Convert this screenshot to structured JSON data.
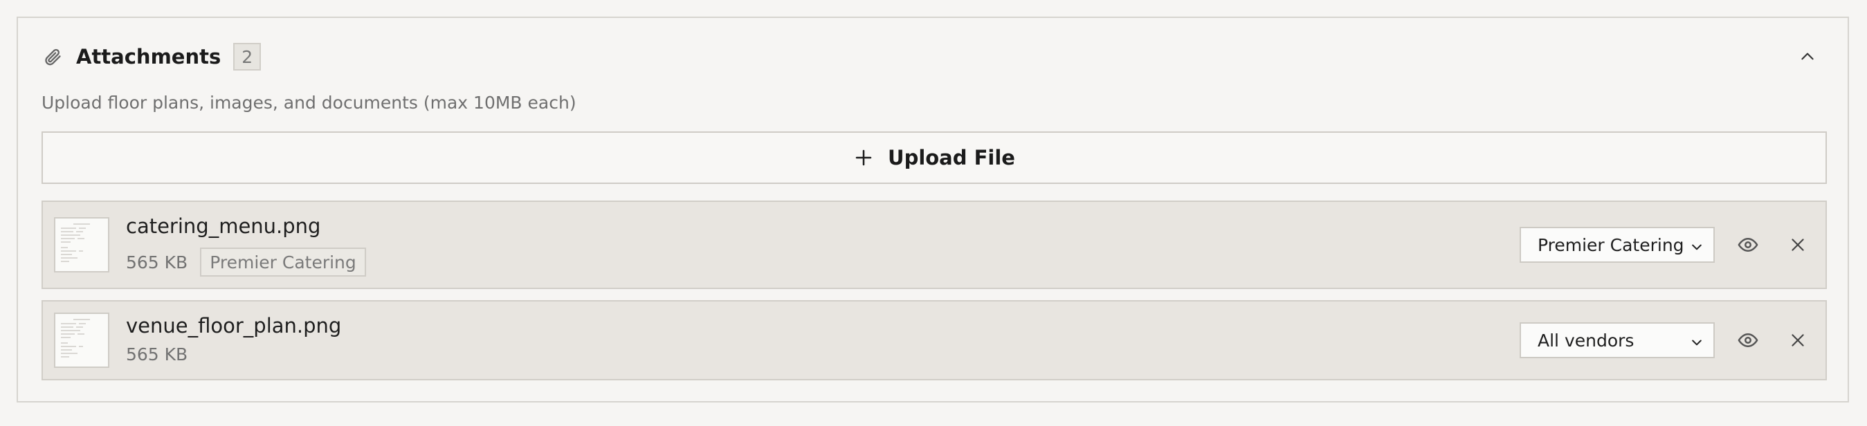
{
  "header": {
    "title": "Attachments",
    "count": "2",
    "icons": {
      "attach": "paperclip-icon",
      "collapse": "chevron-up-icon"
    }
  },
  "description": "Upload floor plans, images, and documents (max 10MB each)",
  "upload": {
    "label": "Upload File",
    "icon": "plus-icon"
  },
  "files": [
    {
      "name": "catering_menu.png",
      "size": "565 KB",
      "tag": "Premier Catering",
      "visibility": "Premier Catering"
    },
    {
      "name": "venue_floor_plan.png",
      "size": "565 KB",
      "tag": "",
      "visibility": "All vendors"
    }
  ],
  "row_icons": {
    "preview": "eye-icon",
    "remove": "close-icon"
  },
  "colors": {
    "background": "#f6f5f3",
    "row_background": "#e8e5e0",
    "border": "#d6d4cf",
    "text": "#1f1f1f",
    "muted_text": "#6f6f6f"
  }
}
